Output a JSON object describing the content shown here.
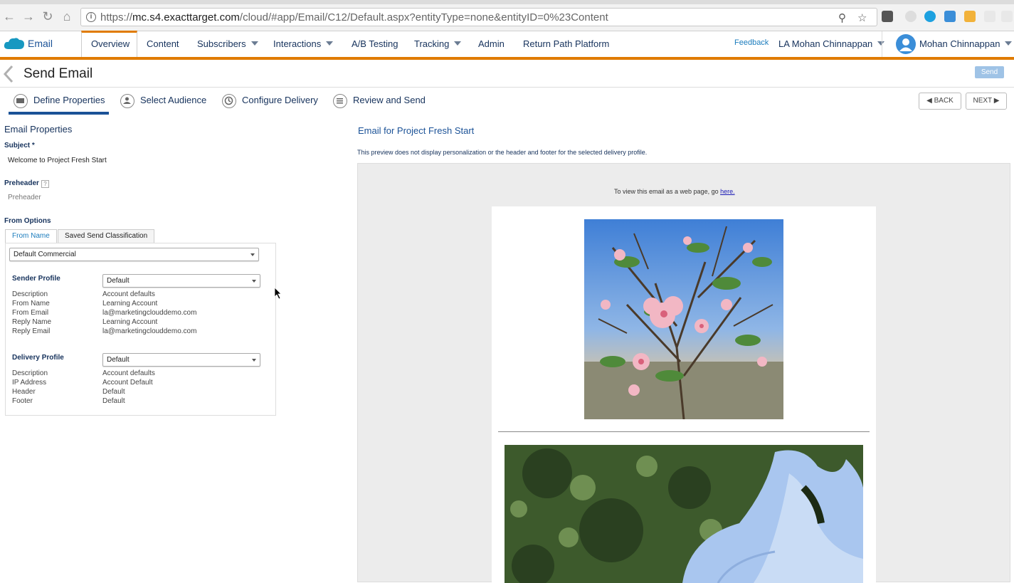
{
  "browser": {
    "url_prefix": "https://",
    "url_host": "mc.s4.exacttarget.com",
    "url_path": "/cloud/#app/Email/C12/Default.aspx?entityType=none&entityID=0%23Content"
  },
  "app": {
    "name": "Email",
    "nav": [
      "Overview",
      "Content",
      "Subscribers",
      "Interactions",
      "A/B Testing",
      "Tracking",
      "Admin",
      "Return Path Platform"
    ],
    "feedback": "Feedback",
    "account": "LA Mohan Chinnappan",
    "user": "Mohan Chinnappan",
    "colors": {
      "accent": "#e07b00",
      "brand": "#1b5297"
    }
  },
  "page": {
    "title": "Send Email",
    "send_label": "Send",
    "steps": [
      "Define Properties",
      "Select Audience",
      "Configure Delivery",
      "Review and Send"
    ],
    "back_label": "BACK",
    "next_label": "NEXT"
  },
  "properties": {
    "section_title": "Email Properties",
    "subject_label": "Subject *",
    "subject_value": "Welcome to Project Fresh Start",
    "preheader_label": "Preheader",
    "preheader_help": "?",
    "preheader_placeholder": "Preheader",
    "from_options_label": "From Options",
    "tabs": [
      "From Name",
      "Saved Send Classification"
    ],
    "classification_value": "Default Commercial",
    "sender_profile": {
      "label": "Sender Profile",
      "value": "Default",
      "rows": [
        {
          "k": "Description",
          "v": "Account defaults"
        },
        {
          "k": "From Name",
          "v": "Learning Account"
        },
        {
          "k": "From Email",
          "v": "la@marketingclouddemo.com"
        },
        {
          "k": "Reply Name",
          "v": "Learning Account"
        },
        {
          "k": "Reply Email",
          "v": "la@marketingclouddemo.com"
        }
      ]
    },
    "delivery_profile": {
      "label": "Delivery Profile",
      "value": "Default",
      "rows": [
        {
          "k": "Description",
          "v": "Account defaults"
        },
        {
          "k": "IP Address",
          "v": "Account Default"
        },
        {
          "k": "Header",
          "v": "Default"
        },
        {
          "k": "Footer",
          "v": "Default"
        }
      ]
    }
  },
  "preview": {
    "title": "Email for Project Fresh Start",
    "note": "This preview does not display personalization or the header and footer for the selected delivery profile.",
    "webview_text": "To view this email as a web page, go ",
    "webview_link": "here."
  }
}
